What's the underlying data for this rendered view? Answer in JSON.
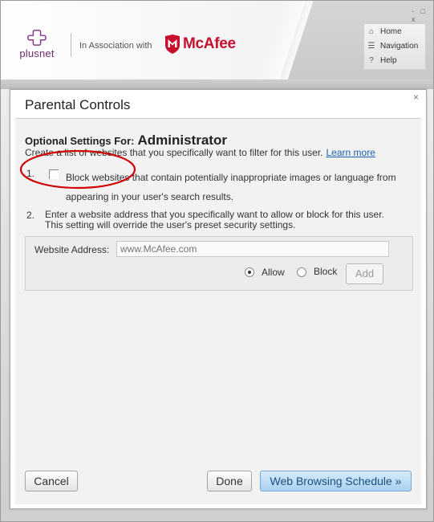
{
  "header": {
    "logo_text": "plusnet",
    "association_text": "In Association with",
    "brand_text": "McAfee",
    "window_controls": "- □ x"
  },
  "nav": {
    "items": [
      {
        "label": "Home",
        "icon": "home-icon"
      },
      {
        "label": "Navigation",
        "icon": "list-icon"
      },
      {
        "label": "Help",
        "icon": "question-icon"
      }
    ]
  },
  "dialog": {
    "title": "Parental Controls",
    "close": "×",
    "optional_prefix": "Optional Settings For:",
    "user": "Administrator",
    "description": "Create a list of websites that you specifically want to filter for this user.",
    "learn_more": "Learn more",
    "item1_number": "1.",
    "item1_text": "Block websites that contain potentially inappropriate images or language from appearing in your user's search results.",
    "item1_checked": false,
    "item2_number": "2.",
    "item2_line1": "Enter a website address that you specifically want to allow or block for this user.",
    "item2_line2": "This setting will override the user's preset security settings.",
    "website_label": "Website Address:",
    "website_placeholder": "www.McAfee.com",
    "allow_label": "Allow",
    "block_label": "Block",
    "selected_option": "Allow",
    "add_label": "Add",
    "cancel_label": "Cancel",
    "done_label": "Done",
    "schedule_label": "Web Browsing Schedule »"
  },
  "colors": {
    "accent_blue": "#a9d1f1",
    "link": "#1a5fb4",
    "mcafee_red": "#c8102e",
    "plusnet_purple": "#6b2d6b",
    "annotation_red": "#d00000"
  }
}
